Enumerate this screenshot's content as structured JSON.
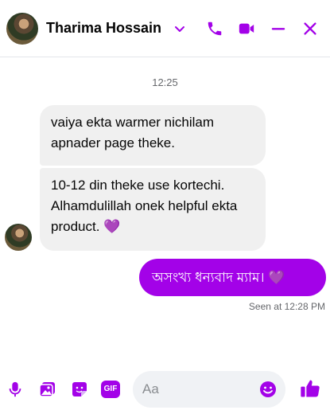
{
  "header": {
    "contact_name": "Tharima Hossain",
    "icons": [
      "chevron-down-icon",
      "phone-icon",
      "video-icon",
      "minimize-icon",
      "close-icon"
    ],
    "accent_color": "#a302e8"
  },
  "conversation": {
    "time_separator": "12:25",
    "incoming": [
      {
        "text": "vaiya ekta warmer nichilam apnader page theke."
      },
      {
        "text": "10-12 din theke use kortechi. Alhamdulillah onek helpful ekta product.",
        "emoji": "💜"
      }
    ],
    "outgoing": [
      {
        "text": "অসংখ্য ধন্যবাদ ম্যাম।",
        "emoji": "💜"
      }
    ],
    "seen_status": "Seen at 12:28 PM"
  },
  "composer": {
    "placeholder": "Aa",
    "gif_label": "GIF",
    "icons": [
      "microphone-icon",
      "photo-icon",
      "sticker-icon",
      "gif-icon",
      "emoji-icon",
      "thumbs-up-icon"
    ]
  }
}
